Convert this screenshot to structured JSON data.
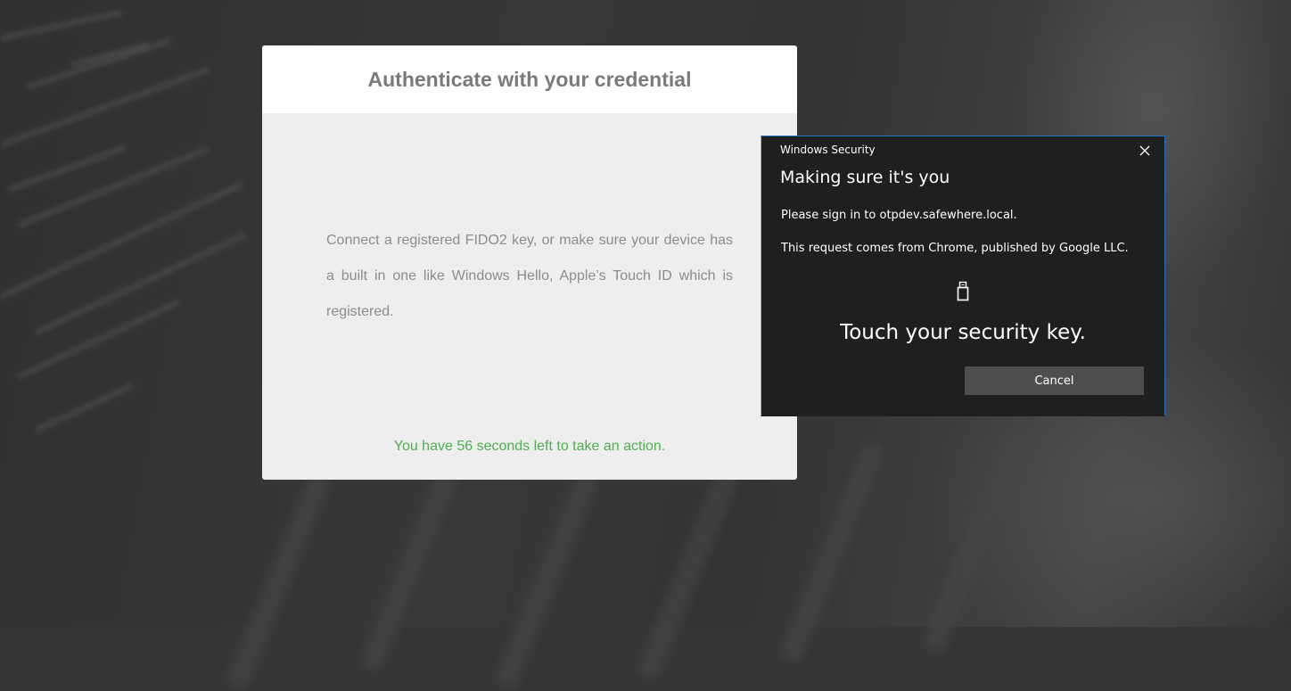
{
  "page": {
    "title": "Authenticate with your credential",
    "instructions": "Connect a registered FIDO2 key, or make sure your device has a built in one like Windows Hello, Apple’s Touch ID which is registered.",
    "countdown_text": "You have 56 seconds left to take an action.",
    "countdown_seconds": 56,
    "colors": {
      "countdown": "#4caf50",
      "title": "#7a7a7a",
      "card_body_bg": "#eeeeee"
    }
  },
  "dialog": {
    "app_name": "Windows Security",
    "title": "Making sure it's you",
    "sign_in_text": "Please sign in to otpdev.safewhere.local.",
    "request_text": "This request comes from Chrome, published by Google LLC.",
    "icon": "usb-security-key-icon",
    "prompt": "Touch your security key.",
    "cancel_label": "Cancel",
    "close_icon": "close-icon",
    "colors": {
      "background": "#1f1f1f",
      "accent_border": "#1e73c8",
      "button": "#4e4e4e"
    }
  }
}
